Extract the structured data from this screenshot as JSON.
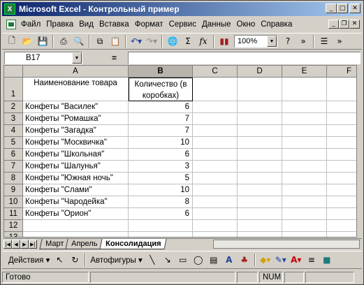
{
  "window": {
    "title": "Microsoft Excel - Контрольный пример",
    "app_icon": "X"
  },
  "menu": [
    "Файл",
    "Правка",
    "Вид",
    "Вставка",
    "Формат",
    "Сервис",
    "Данные",
    "Окно",
    "Справка"
  ],
  "toolbar": {
    "zoom": "100%"
  },
  "formula_bar": {
    "cell_ref": "B17",
    "equals": "=",
    "value": ""
  },
  "columns": [
    "A",
    "B",
    "C",
    "D",
    "E",
    "F"
  ],
  "header_row": {
    "row": "1",
    "a": "Наименование товара",
    "b_line1": "Количество (в",
    "b_line2": "коробках)"
  },
  "rows": [
    {
      "row": "2",
      "name": "Конфеты \"Василек\"",
      "qty": "6"
    },
    {
      "row": "3",
      "name": "Конфеты \"Ромашка\"",
      "qty": "7"
    },
    {
      "row": "4",
      "name": "Конфеты \"Загадка\"",
      "qty": "7"
    },
    {
      "row": "5",
      "name": "Конфеты \"Москвичка\"",
      "qty": "10"
    },
    {
      "row": "6",
      "name": "Конфеты \"Школьная\"",
      "qty": "6"
    },
    {
      "row": "7",
      "name": "Конфеты \"Шалунья\"",
      "qty": "3"
    },
    {
      "row": "8",
      "name": "Конфеты \"Южная ночь\"",
      "qty": "5"
    },
    {
      "row": "9",
      "name": "Конфеты \"Слами\"",
      "qty": "10"
    },
    {
      "row": "10",
      "name": "Конфеты \"Чародейка\"",
      "qty": "8"
    },
    {
      "row": "11",
      "name": "Конфеты \"Орион\"",
      "qty": "6"
    },
    {
      "row": "12",
      "name": "",
      "qty": ""
    },
    {
      "row": "13",
      "name": "",
      "qty": ""
    }
  ],
  "sheets": [
    "Март",
    "Апрель",
    "Консолидация"
  ],
  "active_sheet": "Консолидация",
  "drawing": {
    "actions": "Действия ▾",
    "autoshapes": "Автофигуры ▾"
  },
  "status": {
    "ready": "Готово",
    "num": "NUM"
  }
}
